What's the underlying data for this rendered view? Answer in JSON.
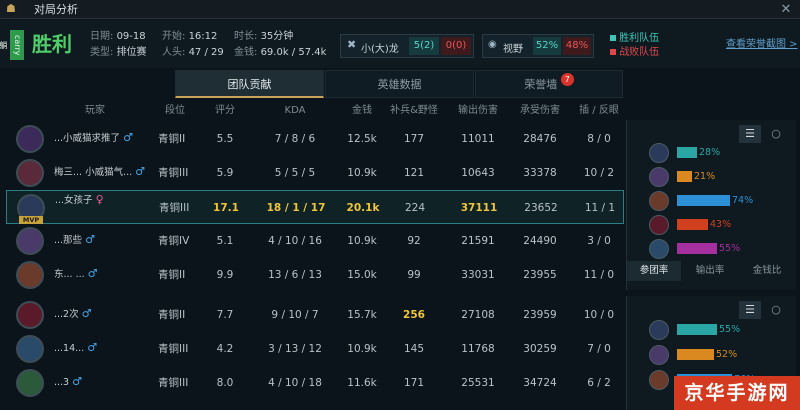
{
  "window": {
    "title": "对局分析",
    "close_icon": "close-icon"
  },
  "header": {
    "result_badge": "carry 躺",
    "result": "胜利",
    "date_label": "日期:",
    "date": "09-18",
    "type_label": "类型:",
    "type": "排位赛",
    "start_label": "开始:",
    "start": "16:12",
    "players_label": "人头:",
    "players": "47 / 29",
    "duration_label": "时长:",
    "duration": "35分钟",
    "gold_label": "金钱:",
    "gold": "69.0k / 57.4k",
    "dragon_label": "小(大)龙",
    "dragon_win": "5(2)",
    "dragon_lose": "0(0)",
    "vision_label": "视野",
    "vision_win": "52%",
    "vision_lose": "48%",
    "legend_win": "胜利队伍",
    "legend_lose": "战败队伍",
    "honor_link": "查看荣誉截图 >"
  },
  "tabs": [
    {
      "label": "团队贡献",
      "active": true
    },
    {
      "label": "英雄数据",
      "active": false
    },
    {
      "label": "荣誉墙",
      "active": false,
      "badge": "7"
    }
  ],
  "columns": [
    "玩家",
    "段位",
    "评分",
    "KDA",
    "金钱",
    "补兵&野怪",
    "输出伤害",
    "承受伤害",
    "插 / 反眼"
  ],
  "win_rows": [
    {
      "name": "...小威猫求推了",
      "gender": "♂",
      "rank": "青铜II",
      "score": "5.5",
      "kda": "7 / 8 / 6",
      "gold": "12.5k",
      "cs": "177",
      "dmg": "11011",
      "taken": "28476",
      "wards": "8 / 0"
    },
    {
      "name": "梅三... 小威猫气...",
      "gender": "♂",
      "rank": "青铜III",
      "score": "5.9",
      "kda": "5 / 5 / 5",
      "gold": "10.9k",
      "cs": "121",
      "dmg": "10643",
      "taken": "33378",
      "wards": "10 / 2"
    },
    {
      "name": "...女孩子",
      "gender": "♀",
      "mvp": "MVP",
      "rank": "青铜III",
      "score": "17.1",
      "kda": "18 / 1 / 17",
      "gold": "20.1k",
      "cs": "224",
      "dmg": "37111",
      "taken": "23652",
      "wards": "11 / 1",
      "selected": true
    },
    {
      "name": "...那些",
      "gender": "♂",
      "rank": "青铜IV",
      "score": "5.1",
      "kda": "4 / 10 / 16",
      "gold": "10.9k",
      "cs": "92",
      "dmg": "21591",
      "taken": "24490",
      "wards": "3 / 0"
    },
    {
      "name": "东... ...",
      "gender": "♂",
      "rank": "青铜II",
      "score": "9.9",
      "kda": "13 / 6 / 13",
      "gold": "15.0k",
      "cs": "99",
      "dmg": "33031",
      "taken": "23955",
      "wards": "11 / 0"
    }
  ],
  "lose_rows": [
    {
      "name": "...2次",
      "gender": "♂",
      "rank": "青铜II",
      "score": "7.7",
      "kda": "9 / 10 / 7",
      "gold": "15.7k",
      "cs": "256",
      "dmg": "27108",
      "taken": "23959",
      "wards": "10 / 0"
    },
    {
      "name": "...14...",
      "gender": "♂",
      "rank": "青铜III",
      "score": "4.2",
      "kda": "3 / 13 / 12",
      "gold": "10.9k",
      "cs": "145",
      "dmg": "11768",
      "taken": "30259",
      "wards": "7 / 0"
    },
    {
      "name": "...3",
      "gender": "♂",
      "rank": "青铜III",
      "score": "8.0",
      "kda": "4 / 10 / 18",
      "gold": "11.6k",
      "cs": "171",
      "dmg": "25531",
      "taken": "34724",
      "wards": "6 / 2"
    }
  ],
  "win_panel": {
    "bars": [
      {
        "pct": "28%",
        "value": 0.28,
        "color": "#2aa7a5"
      },
      {
        "pct": "21%",
        "value": 0.21,
        "color": "#d9891f"
      },
      {
        "pct": "74%",
        "value": 0.74,
        "color": "#2d8fd6"
      },
      {
        "pct": "43%",
        "value": 0.43,
        "color": "#d0401f"
      },
      {
        "pct": "55%",
        "value": 0.55,
        "color": "#a52f9e"
      }
    ],
    "tabs": [
      "参团率",
      "输出率",
      "金钱比"
    ]
  },
  "lose_panel": {
    "bars": [
      {
        "pct": "55%",
        "value": 0.55,
        "color": "#2aa7a5"
      },
      {
        "pct": "52%",
        "value": 0.52,
        "color": "#d9891f"
      },
      {
        "pct": "76%",
        "value": 0.76,
        "color": "#2d8fd6"
      }
    ]
  },
  "watermark": "京华手游网"
}
